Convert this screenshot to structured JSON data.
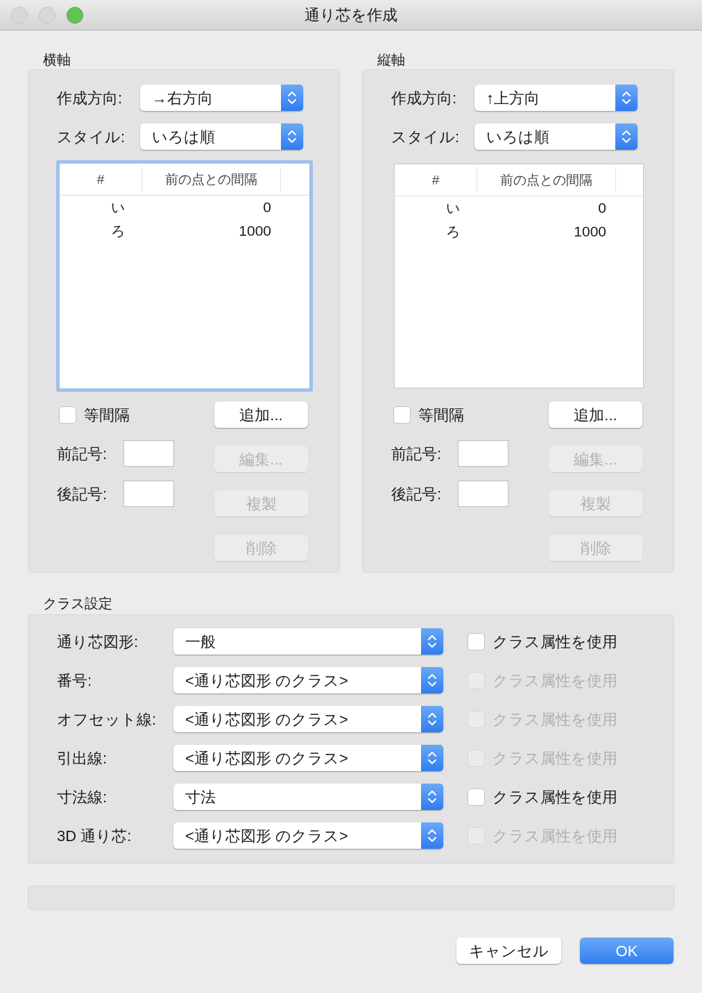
{
  "window": {
    "title": "通り芯を作成"
  },
  "axes": [
    {
      "title": "横軸",
      "direction": {
        "label": "作成方向:",
        "value": "→右方向"
      },
      "style": {
        "label": "スタイル:",
        "value": "いろは順"
      },
      "table": {
        "focused": true,
        "columns": [
          "#",
          "前の点との間隔"
        ],
        "rows": [
          [
            "い",
            "0"
          ],
          [
            "ろ",
            "1000"
          ]
        ]
      },
      "equal_spacing": {
        "label": "等間隔",
        "checked": false
      },
      "prefix": {
        "label": "前記号:"
      },
      "suffix": {
        "label": "後記号:"
      },
      "buttons": [
        {
          "label": "追加...",
          "disabled": false
        },
        {
          "label": "編集...",
          "disabled": true
        },
        {
          "label": "複製",
          "disabled": true
        },
        {
          "label": "削除",
          "disabled": true
        }
      ]
    },
    {
      "title": "縦軸",
      "direction": {
        "label": "作成方向:",
        "value": "↑上方向"
      },
      "style": {
        "label": "スタイル:",
        "value": "いろは順"
      },
      "table": {
        "focused": false,
        "columns": [
          "#",
          "前の点との間隔"
        ],
        "rows": [
          [
            "い",
            "0"
          ],
          [
            "ろ",
            "1000"
          ]
        ]
      },
      "equal_spacing": {
        "label": "等間隔",
        "checked": false
      },
      "prefix": {
        "label": "前記号:"
      },
      "suffix": {
        "label": "後記号:"
      },
      "buttons": [
        {
          "label": "追加...",
          "disabled": false
        },
        {
          "label": "編集...",
          "disabled": true
        },
        {
          "label": "複製",
          "disabled": true
        },
        {
          "label": "削除",
          "disabled": true
        }
      ]
    }
  ],
  "class_settings": {
    "title": "クラス設定",
    "rows": [
      {
        "label": "通り芯図形:",
        "value": "一般",
        "use_class": {
          "label": "クラス属性を使用",
          "checked": false,
          "disabled": false
        }
      },
      {
        "label": "番号:",
        "value": "<通り芯図形 のクラス>",
        "use_class": {
          "label": "クラス属性を使用",
          "checked": false,
          "disabled": true
        }
      },
      {
        "label": "オフセット線:",
        "value": "<通り芯図形 のクラス>",
        "use_class": {
          "label": "クラス属性を使用",
          "checked": false,
          "disabled": true
        }
      },
      {
        "label": "引出線:",
        "value": "<通り芯図形 のクラス>",
        "use_class": {
          "label": "クラス属性を使用",
          "checked": false,
          "disabled": true
        }
      },
      {
        "label": "寸法線:",
        "value": "寸法",
        "use_class": {
          "label": "クラス属性を使用",
          "checked": false,
          "disabled": false
        }
      },
      {
        "label": "3D 通り芯:",
        "value": "<通り芯図形 のクラス>",
        "use_class": {
          "label": "クラス属性を使用",
          "checked": false,
          "disabled": true
        }
      }
    ]
  },
  "buttons": [
    {
      "label": "キャンセル",
      "kind": "default"
    },
    {
      "label": "OK",
      "kind": "primary"
    }
  ]
}
